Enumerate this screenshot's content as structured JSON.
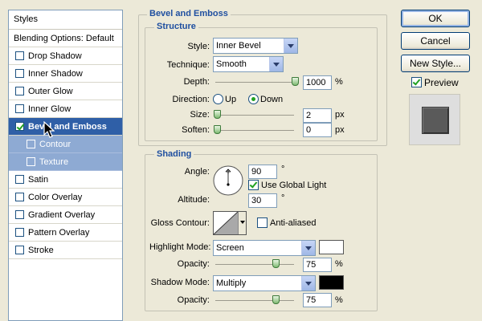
{
  "styles_panel": {
    "header": "Styles",
    "blending_options": "Blending Options: Default",
    "items": [
      {
        "label": "Drop Shadow",
        "checked": false
      },
      {
        "label": "Inner Shadow",
        "checked": false
      },
      {
        "label": "Outer Glow",
        "checked": false
      },
      {
        "label": "Inner Glow",
        "checked": false
      },
      {
        "label": "Bevel and Emboss",
        "checked": true,
        "selected": true
      },
      {
        "label": "Contour",
        "checked": false,
        "sub": true
      },
      {
        "label": "Texture",
        "checked": false,
        "sub": true
      },
      {
        "label": "Satin",
        "checked": false
      },
      {
        "label": "Color Overlay",
        "checked": false
      },
      {
        "label": "Gradient Overlay",
        "checked": false
      },
      {
        "label": "Pattern Overlay",
        "checked": false
      },
      {
        "label": "Stroke",
        "checked": false
      }
    ]
  },
  "bevel": {
    "title": "Bevel and Emboss",
    "structure_title": "Structure",
    "style_label": "Style:",
    "style_value": "Inner Bevel",
    "technique_label": "Technique:",
    "technique_value": "Smooth",
    "depth_label": "Depth:",
    "depth_value": "1000",
    "depth_unit": "%",
    "direction_label": "Direction:",
    "direction_up": "Up",
    "direction_down": "Down",
    "direction_selected": "Down",
    "size_label": "Size:",
    "size_value": "2",
    "size_unit": "px",
    "soften_label": "Soften:",
    "soften_value": "0",
    "soften_unit": "px"
  },
  "shading": {
    "title": "Shading",
    "angle_label": "Angle:",
    "angle_value": "90",
    "angle_unit": "°",
    "use_global_light": "Use Global Light",
    "use_global_light_checked": true,
    "altitude_label": "Altitude:",
    "altitude_value": "30",
    "altitude_unit": "°",
    "gloss_contour_label": "Gloss Contour:",
    "anti_aliased": "Anti-aliased",
    "anti_aliased_checked": false,
    "highlight_mode_label": "Highlight Mode:",
    "highlight_mode_value": "Screen",
    "highlight_color": "#ffffff",
    "highlight_opacity_label": "Opacity:",
    "highlight_opacity_value": "75",
    "highlight_opacity_unit": "%",
    "shadow_mode_label": "Shadow Mode:",
    "shadow_mode_value": "Multiply",
    "shadow_color": "#000000",
    "shadow_opacity_label": "Opacity:",
    "shadow_opacity_value": "75",
    "shadow_opacity_unit": "%"
  },
  "buttons": {
    "ok": "OK",
    "cancel": "Cancel",
    "new_style": "New Style...",
    "preview": "Preview",
    "preview_checked": true
  },
  "colors": {
    "accent": "#2f5fa7",
    "section_title": "#1f4fa0",
    "preview_swatch": "#5a5a5a"
  },
  "icons": {
    "cursor": "arrow-cursor-icon",
    "angle_dial": "angle-dial-icon",
    "gloss_contour": "contour-curve-icon"
  }
}
